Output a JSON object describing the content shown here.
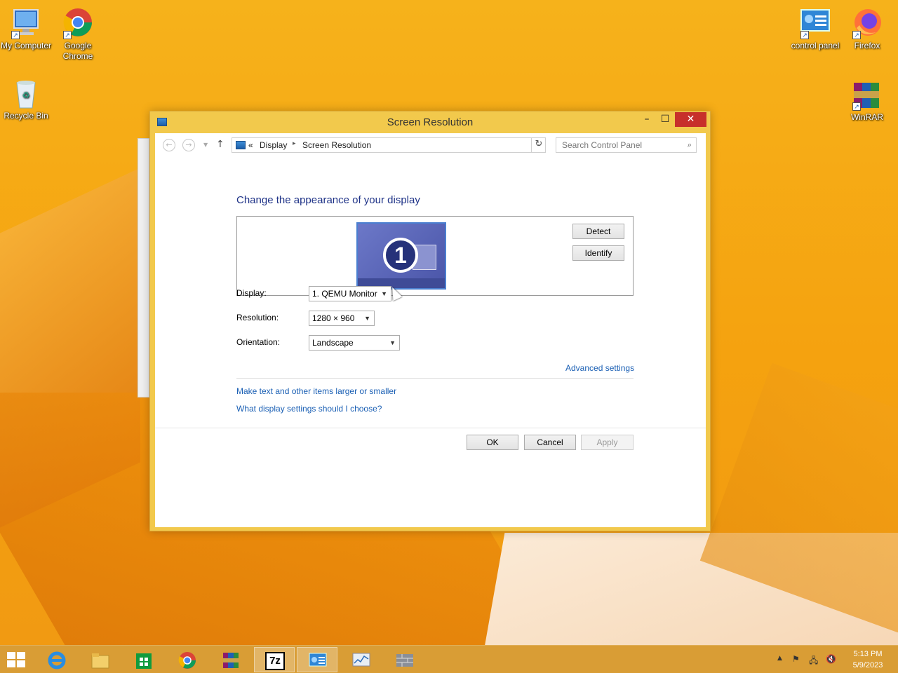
{
  "desktop": {
    "icons": [
      {
        "label": "My Computer"
      },
      {
        "label": "Google Chrome"
      },
      {
        "label": "Recycle Bin"
      },
      {
        "label": "control panel"
      },
      {
        "label": "Firefox"
      },
      {
        "label": "WinRAR"
      }
    ]
  },
  "window": {
    "title": "Screen Resolution",
    "controls": {
      "minimize": "–",
      "maximize": "☐",
      "close": "✕"
    },
    "address": {
      "overflow": "«",
      "crumbs": [
        "Display",
        "Screen Resolution"
      ],
      "separator": "▸"
    },
    "search": {
      "placeholder": "Search Control Panel"
    },
    "heading": "Change the appearance of your display",
    "monitor": {
      "number": "1"
    },
    "buttons": {
      "detect": "Detect",
      "identify": "Identify",
      "ok": "OK",
      "cancel": "Cancel",
      "apply": "Apply"
    },
    "form": {
      "display_label": "Display:",
      "display_value": "1. QEMU Monitor",
      "resolution_label": "Resolution:",
      "resolution_value": "1280 × 960",
      "orientation_label": "Orientation:",
      "orientation_value": "Landscape"
    },
    "links": {
      "advanced": "Advanced settings",
      "text_size": "Make text and other items larger or smaller",
      "help": "What display settings should I choose?"
    }
  },
  "taskbar": {
    "clock_time": "5:13 PM",
    "clock_date": "5/9/2023",
    "sevenzip_label": "7z"
  }
}
